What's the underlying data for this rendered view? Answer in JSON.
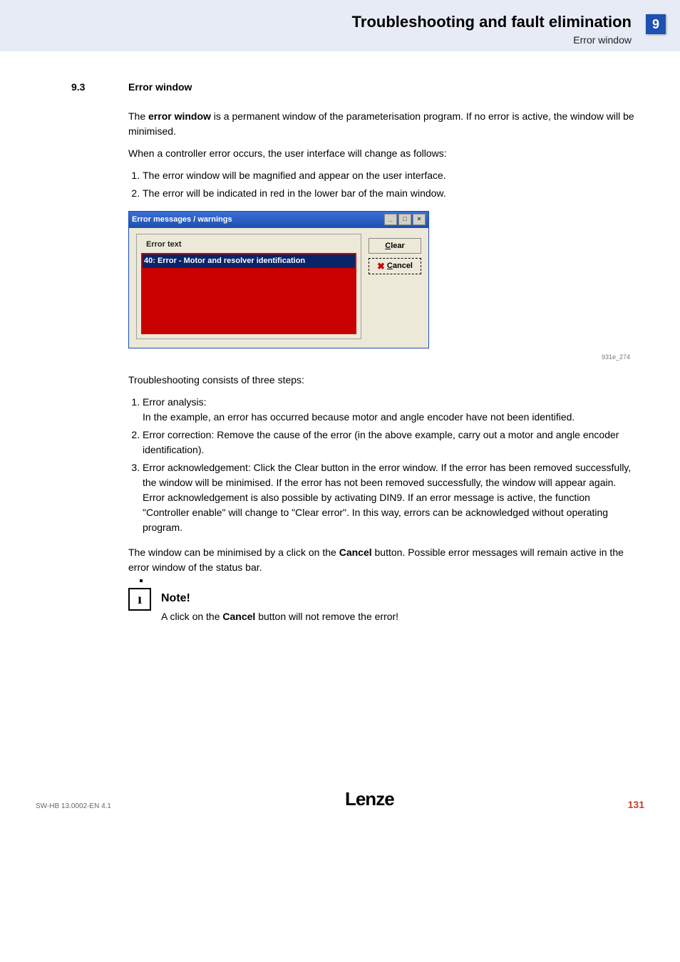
{
  "header": {
    "title": "Troubleshooting and fault elimination",
    "sub": "Error window",
    "chapter": "9"
  },
  "section": {
    "num": "9.3",
    "title": "Error window"
  },
  "intro": {
    "p1a": "The ",
    "p1b": "error window",
    "p1c": " is a permanent window of the parameterisation program. If no error is active, the window will be minimised.",
    "p2": "When a controller error occurs, the user interface will change as follows:",
    "li1": "The error window will be magnified and appear on the user interface.",
    "li2": "The error will be indicated in red in the lower bar of the main window."
  },
  "dialog": {
    "title": "Error messages / warnings",
    "legend": "Error text",
    "entry": "40: Error - Motor and resolver identification",
    "btn_clear": "lear",
    "btn_clear_u": "C",
    "btn_cancel": "ancel",
    "btn_cancel_u": "C"
  },
  "fig_caption": "931e_274",
  "after": {
    "p1": "Troubleshooting consists of three steps:",
    "li1_title": "Error analysis:",
    "li1_body": "In the example, an error has occurred because motor and angle encoder have not been identified.",
    "li2": "Error correction: Remove the cause of the error (in the above example, carry out a motor and angle encoder identification).",
    "li3": "Error acknowledgement: Click the Clear button in the error window. If the error has been removed successfully, the window will be minimised. If the error has not been removed successfully, the window will appear again. Error acknowledgement is also possible by activating DIN9. If an error message is active, the function \"Controller enable\" will change to \"Clear error\". In this way, errors can be acknowledged without operating program.",
    "p2a": "The window can be minimised by a click on the ",
    "p2b": "Cancel",
    "p2c": " button. Possible error messages  will remain active in the error window of the status bar."
  },
  "note": {
    "title": "Note!",
    "body_a": "A click on the ",
    "body_b": "Cancel",
    "body_c": " button will not remove the error!"
  },
  "footer": {
    "left": "SW-HB 13.0002-EN     4.1",
    "logo": "Lenze",
    "right": "131"
  }
}
